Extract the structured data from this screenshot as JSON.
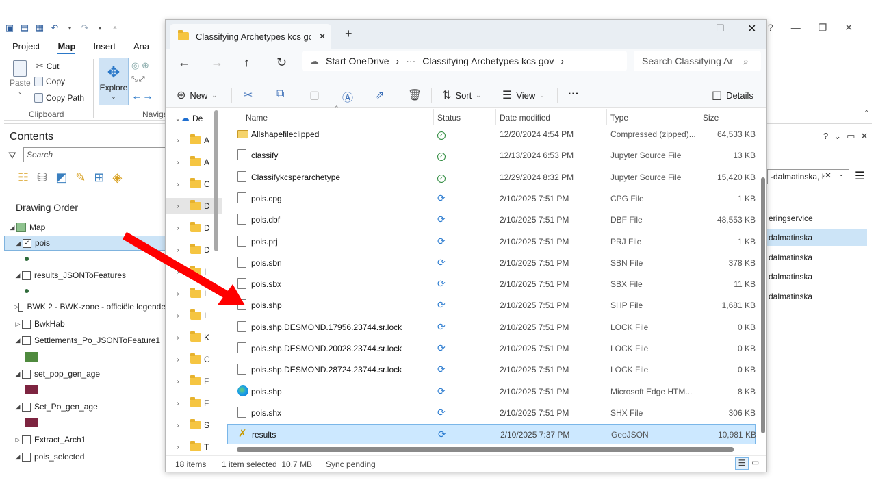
{
  "arcgis": {
    "tabs": [
      "Project",
      "Map",
      "Insert",
      "Ana"
    ],
    "active_tab": "Map",
    "ribbon": {
      "cut": "Cut",
      "copy": "Copy",
      "copy_path": "Copy Path",
      "paste": "Paste",
      "explore": "Explore",
      "group_clipboard": "Clipboard",
      "group_navigate": "Naviga"
    },
    "contents": {
      "title": "Contents",
      "search_placeholder": "Search",
      "drawing_order": "Drawing Order",
      "map_label": "Map",
      "layers": [
        {
          "label": "pois",
          "checked": true,
          "selected": true
        },
        {
          "label": "results_JSONToFeatures",
          "checked": false
        },
        {
          "label": "BWK 2 - BWK-zone - officiële legende",
          "checked": false
        },
        {
          "label": "BwkHab",
          "checked": false
        },
        {
          "label": "Settlements_Po_JSONToFeature1",
          "checked": false
        },
        {
          "label": "set_pop_gen_age",
          "checked": false
        },
        {
          "label": "Set_Po_gen_age",
          "checked": false
        },
        {
          "label": "Extract_Arch1",
          "checked": false
        },
        {
          "label": "pois_selected",
          "checked": false
        }
      ],
      "swatch_colors": [
        "#2f6b3a",
        "#4f8a3e",
        "#7d2440",
        "#7d2440"
      ]
    },
    "right_pane": {
      "combo_value": "-dalmatinska, Ł",
      "items": [
        "eringservice",
        "dalmatinska",
        "dalmatinska",
        "dalmatinska",
        "dalmatinska"
      ],
      "selected_index": 1
    }
  },
  "explorer": {
    "tab_title": "Classifying Archetypes kcs gov",
    "breadcrumb": [
      "Start OneDrive",
      "Classifying Archetypes kcs gov"
    ],
    "search_placeholder": "Search Classifying Ar",
    "commands": {
      "new": "New",
      "sort": "Sort",
      "view": "View",
      "details": "Details"
    },
    "nav_root": "De",
    "nav_items": [
      "A",
      "A",
      "C",
      "D",
      "D",
      "D",
      "I",
      "I",
      "I",
      "K",
      "C",
      "F",
      "F",
      "S",
      "T"
    ],
    "columns": {
      "name": "Name",
      "status": "Status",
      "date": "Date modified",
      "type": "Type",
      "size": "Size"
    },
    "files": [
      {
        "name": "Allshapefileclipped",
        "status": "ok",
        "date": "12/20/2024 4:54 PM",
        "type": "Compressed (zipped)...",
        "size": "64,533 KB",
        "icon": "zip"
      },
      {
        "name": "classify",
        "status": "ok",
        "date": "12/13/2024 6:53 PM",
        "type": "Jupyter Source File",
        "size": "13 KB",
        "icon": "file"
      },
      {
        "name": "Classifykcsperarchetype",
        "status": "ok",
        "date": "12/29/2024 8:32 PM",
        "type": "Jupyter Source File",
        "size": "15,420 KB",
        "icon": "file"
      },
      {
        "name": "pois.cpg",
        "status": "sync",
        "date": "2/10/2025 7:51 PM",
        "type": "CPG File",
        "size": "1 KB",
        "icon": "file"
      },
      {
        "name": "pois.dbf",
        "status": "sync",
        "date": "2/10/2025 7:51 PM",
        "type": "DBF File",
        "size": "48,553 KB",
        "icon": "file"
      },
      {
        "name": "pois.prj",
        "status": "sync",
        "date": "2/10/2025 7:51 PM",
        "type": "PRJ File",
        "size": "1 KB",
        "icon": "file"
      },
      {
        "name": "pois.sbn",
        "status": "sync",
        "date": "2/10/2025 7:51 PM",
        "type": "SBN File",
        "size": "378 KB",
        "icon": "file"
      },
      {
        "name": "pois.sbx",
        "status": "sync",
        "date": "2/10/2025 7:51 PM",
        "type": "SBX File",
        "size": "11 KB",
        "icon": "file"
      },
      {
        "name": "pois.shp",
        "status": "sync",
        "date": "2/10/2025 7:51 PM",
        "type": "SHP File",
        "size": "1,681 KB",
        "icon": "file"
      },
      {
        "name": "pois.shp.DESMOND.17956.23744.sr.lock",
        "status": "sync",
        "date": "2/10/2025 7:51 PM",
        "type": "LOCK File",
        "size": "0 KB",
        "icon": "file"
      },
      {
        "name": "pois.shp.DESMOND.20028.23744.sr.lock",
        "status": "sync",
        "date": "2/10/2025 7:51 PM",
        "type": "LOCK File",
        "size": "0 KB",
        "icon": "file"
      },
      {
        "name": "pois.shp.DESMOND.28724.23744.sr.lock",
        "status": "sync",
        "date": "2/10/2025 7:51 PM",
        "type": "LOCK File",
        "size": "0 KB",
        "icon": "file"
      },
      {
        "name": "pois.shp",
        "status": "sync",
        "date": "2/10/2025 7:51 PM",
        "type": "Microsoft Edge HTM...",
        "size": "8 KB",
        "icon": "edge"
      },
      {
        "name": "pois.shx",
        "status": "sync",
        "date": "2/10/2025 7:51 PM",
        "type": "SHX File",
        "size": "306 KB",
        "icon": "file"
      },
      {
        "name": "results",
        "status": "sync",
        "date": "2/10/2025 7:37 PM",
        "type": "GeoJSON",
        "size": "10,981 KB",
        "icon": "geo",
        "selected": true
      }
    ],
    "status": {
      "count": "18 items",
      "selected": "1 item selected  10.7 MB",
      "sync": "Sync pending"
    }
  },
  "annotation": {
    "arrow_color": "#ff0000"
  }
}
